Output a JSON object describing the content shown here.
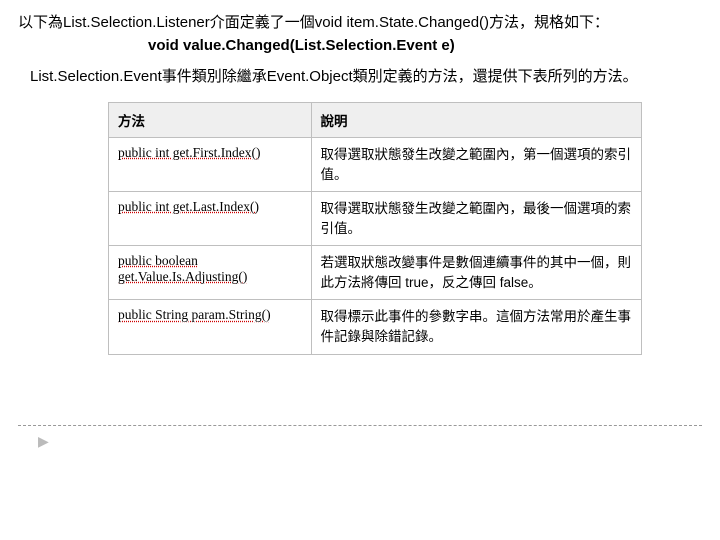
{
  "intro": {
    "line1_a": "以下為",
    "line1_b": "List.Selection.Listener",
    "line1_c": "介面定義了一個",
    "line1_d": "void item.State.Changed()",
    "line1_e": "方法，規格如下：",
    "signature": "void value.Changed(List.Selection.Event e)",
    "line2_a": "List.Selection.Event",
    "line2_b": "事件類別除繼承",
    "line2_c": "Event.Object",
    "line2_d": "類別定義的方法，還提供下表所列的方法。"
  },
  "table": {
    "head_method": "方法",
    "head_desc": "說明",
    "rows": [
      {
        "method": "public int get.First.Index()",
        "desc": "取得選取狀態發生改變之範圍內，第一個選項的索引值。"
      },
      {
        "method": "public int get.Last.Index()",
        "desc": "取得選取狀態發生改變之範圍內，最後一個選項的索引值。"
      },
      {
        "method": "public boolean get.Value.Is.Adjusting()",
        "desc": "若選取狀態改變事件是數個連續事件的其中一個，則此方法將傳回 true，反之傳回 false。"
      },
      {
        "method": "public String param.String()",
        "desc": "取得標示此事件的參數字串。這個方法常用於產生事件記錄與除錯記錄。"
      }
    ]
  }
}
